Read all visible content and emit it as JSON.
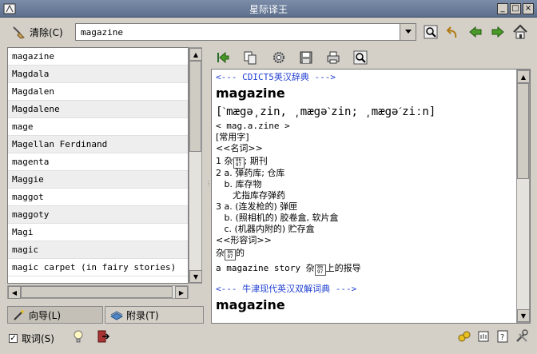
{
  "window": {
    "title": "星际译王"
  },
  "toolbar": {
    "clear_label": "清除(C)",
    "search_value": "magazine"
  },
  "word_list": [
    "magazine",
    "Magdala",
    "Magdalen",
    "Magdalene",
    "mage",
    "Magellan Ferdinand",
    "magenta",
    "Maggie",
    "maggot",
    "maggoty",
    "Magi",
    "magic",
    "magic carpet (in fairy stories)"
  ],
  "tabs": {
    "guide": "向导(L)",
    "appendix": "附录(T)"
  },
  "status": {
    "scan_label": "取词(S)"
  },
  "definition": {
    "dict1_header": "<--- CDICT5英汉辞典 --->",
    "headword": "magazine",
    "phonetic": "[ˋmægə͵zin, ͵mægəˋzin; ͵mægəˊziːn]",
    "syllables": "< mag.a.zine >",
    "common": "[常用字]",
    "pos_noun": "<<名词>>",
    "l1_pre": "1 杂",
    "l1_post": "; 期刊",
    "l2": "2 a. 弹药库; 仓库",
    "l3": "   b. 库存物",
    "l4": "      尤指库存弹药",
    "l5": "3 a. (连发枪的) 弹匣",
    "l6": "   b. (照相机的) 胶卷盒, 软片盒",
    "l7": "   c. (机器内附的) 贮存盒",
    "pos_adj": "<<形容词>>",
    "adj_pre": "杂",
    "adj_post": "的",
    "ex_pre": "a magazine story 杂",
    "ex_post": "上的报导",
    "dict2_header": "<--- 牛津现代英汉双解词典 --->",
    "headword2": "magazine"
  }
}
